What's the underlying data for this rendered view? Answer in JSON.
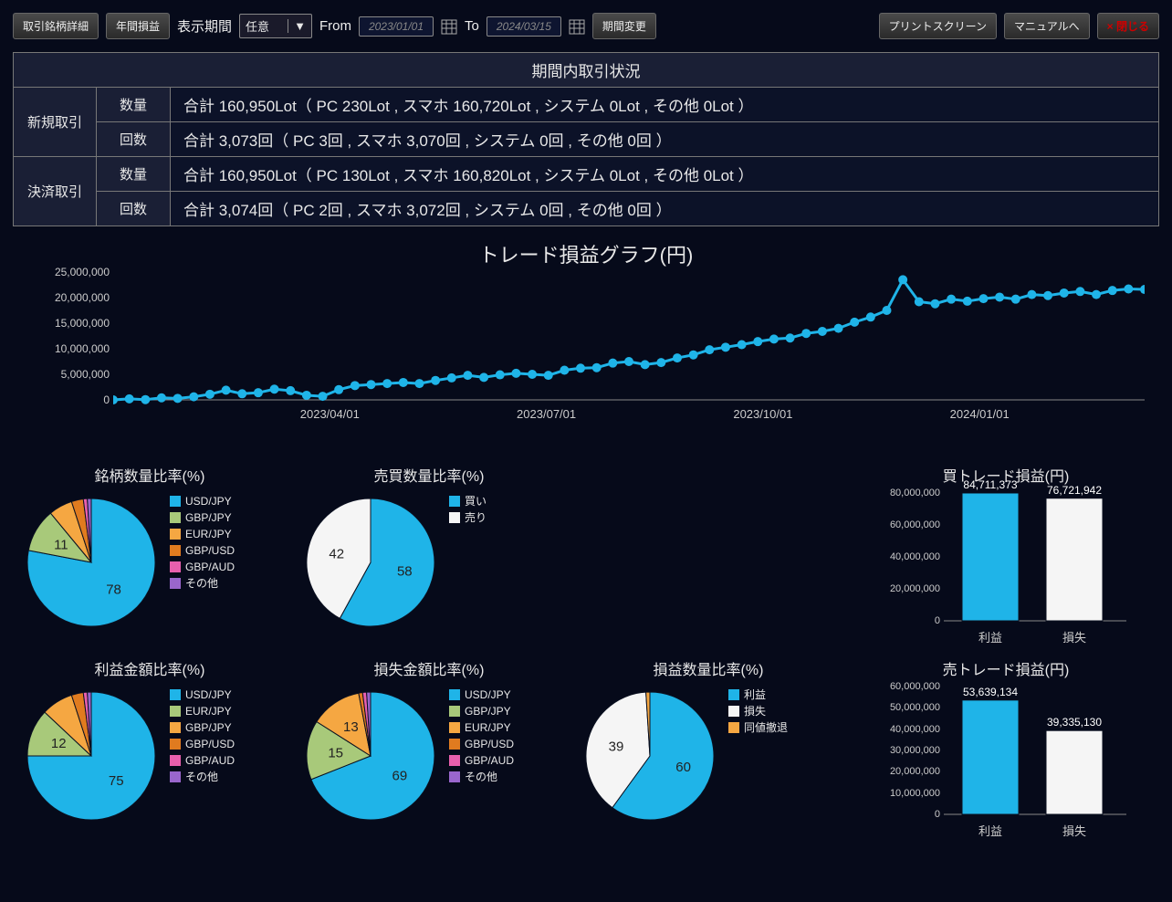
{
  "toolbar": {
    "btn_detail": "取引銘柄詳細",
    "btn_annual": "年間損益",
    "lbl_period": "表示期間",
    "sel_value": "任意",
    "lbl_from": "From",
    "date_from": "2023/01/01",
    "lbl_to": "To",
    "date_to": "2024/03/15",
    "btn_change": "期間変更",
    "btn_print": "プリントスクリーン",
    "btn_manual": "マニュアルへ",
    "btn_close": "× 閉じる"
  },
  "summary": {
    "title": "期間内取引状況",
    "rows": [
      {
        "side": "新規取引",
        "sub": "数量",
        "val": "合計 160,950Lot（ PC 230Lot , スマホ 160,720Lot , システム 0Lot , その他 0Lot ）"
      },
      {
        "side": "",
        "sub": "回数",
        "val": "合計 3,073回（ PC 3回 , スマホ 3,070回 , システム 0回 , その他 0回 ）"
      },
      {
        "side": "決済取引",
        "sub": "数量",
        "val": "合計 160,950Lot（ PC 130Lot , スマホ 160,820Lot , システム 0Lot , その他 0Lot ）"
      },
      {
        "side": "",
        "sub": "回数",
        "val": "合計 3,074回（ PC 2回 , スマホ 3,072回 , システム 0回 , その他 0回 ）"
      }
    ]
  },
  "lineTitle": "トレード損益グラフ(円)",
  "titles": {
    "pie1": "銘柄数量比率(%)",
    "pie2": "売買数量比率(%)",
    "bar1": "買トレード損益(円)",
    "pie3": "利益金額比率(%)",
    "pie4": "損失金額比率(%)",
    "pie5": "損益数量比率(%)",
    "bar2": "売トレード損益(円)"
  },
  "legends": {
    "pairs": [
      "USD/JPY",
      "GBP/JPY",
      "EUR/JPY",
      "GBP/USD",
      "GBP/AUD",
      "その他"
    ],
    "pairs2": [
      "USD/JPY",
      "EUR/JPY",
      "GBP/JPY",
      "GBP/USD",
      "GBP/AUD",
      "その他"
    ],
    "buysell": [
      "買い",
      "売り"
    ],
    "pl": [
      "利益",
      "損失",
      "同値撤退"
    ]
  },
  "bars": {
    "buy": {
      "profit_lbl": "利益",
      "loss_lbl": "損失",
      "profit": "84,711,373",
      "loss": "76,721,942"
    },
    "sell": {
      "profit_lbl": "利益",
      "loss_lbl": "損失",
      "profit": "53,639,134",
      "loss": "39,335,130"
    }
  },
  "chart_data": {
    "line": {
      "type": "line",
      "title": "トレード損益グラフ(円)",
      "ylim": [
        0,
        25000000
      ],
      "yticks": [
        0,
        5000000,
        10000000,
        15000000,
        20000000,
        25000000
      ],
      "xticks": [
        "2023/04/01",
        "2023/07/01",
        "2023/10/01",
        "2024/01/01"
      ],
      "x": [
        "2023/01/01",
        "2023/01/08",
        "2023/01/15",
        "2023/01/22",
        "2023/01/29",
        "2023/02/05",
        "2023/02/12",
        "2023/02/19",
        "2023/02/26",
        "2023/03/05",
        "2023/03/12",
        "2023/03/19",
        "2023/03/26",
        "2023/04/02",
        "2023/04/09",
        "2023/04/16",
        "2023/04/23",
        "2023/04/30",
        "2023/05/07",
        "2023/05/14",
        "2023/05/21",
        "2023/05/28",
        "2023/06/04",
        "2023/06/11",
        "2023/06/18",
        "2023/06/25",
        "2023/07/02",
        "2023/07/09",
        "2023/07/16",
        "2023/07/23",
        "2023/07/30",
        "2023/08/06",
        "2023/08/13",
        "2023/08/20",
        "2023/08/27",
        "2023/09/03",
        "2023/09/10",
        "2023/09/17",
        "2023/09/24",
        "2023/10/01",
        "2023/10/08",
        "2023/10/15",
        "2023/10/22",
        "2023/10/29",
        "2023/11/05",
        "2023/11/12",
        "2023/11/19",
        "2023/11/26",
        "2023/12/03",
        "2023/12/10",
        "2023/12/17",
        "2023/12/24",
        "2023/12/31",
        "2024/01/07",
        "2024/01/14",
        "2024/01/21",
        "2024/01/28",
        "2024/02/04",
        "2024/02/11",
        "2024/02/18",
        "2024/02/25",
        "2024/03/03",
        "2024/03/10",
        "2024/03/15"
      ],
      "values": [
        0,
        200000,
        50000,
        400000,
        300000,
        600000,
        1100000,
        1900000,
        1200000,
        1400000,
        2100000,
        1800000,
        900000,
        700000,
        2000000,
        2800000,
        3000000,
        3200000,
        3400000,
        3200000,
        3800000,
        4300000,
        4800000,
        4400000,
        4900000,
        5200000,
        5000000,
        4800000,
        5800000,
        6200000,
        6300000,
        7200000,
        7500000,
        6900000,
        7300000,
        8200000,
        8800000,
        9800000,
        10300000,
        10800000,
        11400000,
        11900000,
        12100000,
        13000000,
        13400000,
        14000000,
        15200000,
        16200000,
        17500000,
        23500000,
        19200000,
        18800000,
        19700000,
        19300000,
        19800000,
        20100000,
        19700000,
        20600000,
        20400000,
        20900000,
        21200000,
        20600000,
        21400000,
        21700000,
        21600000
      ]
    },
    "pie1": {
      "type": "pie",
      "title": "銘柄数量比率(%)",
      "series": [
        {
          "name": "USD/JPY",
          "value": 78
        },
        {
          "name": "GBP/JPY",
          "value": 11
        },
        {
          "name": "EUR/JPY",
          "value": 6
        },
        {
          "name": "GBP/USD",
          "value": 3
        },
        {
          "name": "GBP/AUD",
          "value": 1
        },
        {
          "name": "その他",
          "value": 1
        }
      ]
    },
    "pie2": {
      "type": "pie",
      "title": "売買数量比率(%)",
      "series": [
        {
          "name": "買い",
          "value": 58
        },
        {
          "name": "売り",
          "value": 42
        }
      ]
    },
    "pie3": {
      "type": "pie",
      "title": "利益金額比率(%)",
      "series": [
        {
          "name": "USD/JPY",
          "value": 75
        },
        {
          "name": "EUR/JPY",
          "value": 12
        },
        {
          "name": "GBP/JPY",
          "value": 8
        },
        {
          "name": "GBP/USD",
          "value": 3
        },
        {
          "name": "GBP/AUD",
          "value": 1
        },
        {
          "name": "その他",
          "value": 1
        }
      ]
    },
    "pie4": {
      "type": "pie",
      "title": "損失金額比率(%)",
      "series": [
        {
          "name": "USD/JPY",
          "value": 69
        },
        {
          "name": "GBP/JPY",
          "value": 15
        },
        {
          "name": "EUR/JPY",
          "value": 13
        },
        {
          "name": "GBP/USD",
          "value": 1
        },
        {
          "name": "GBP/AUD",
          "value": 1
        },
        {
          "name": "その他",
          "value": 1
        }
      ]
    },
    "pie5": {
      "type": "pie",
      "title": "損益数量比率(%)",
      "series": [
        {
          "name": "利益",
          "value": 60
        },
        {
          "name": "損失",
          "value": 39
        },
        {
          "name": "同値撤退",
          "value": 1
        }
      ]
    },
    "bar1": {
      "type": "bar",
      "title": "買トレード損益(円)",
      "categories": [
        "利益",
        "損失"
      ],
      "values": [
        84711373,
        76721942
      ],
      "ylim": [
        0,
        80000000
      ],
      "yticks": [
        0,
        20000000,
        40000000,
        60000000,
        80000000
      ]
    },
    "bar2": {
      "type": "bar",
      "title": "売トレード損益(円)",
      "categories": [
        "利益",
        "損失"
      ],
      "values": [
        53639134,
        39335130
      ],
      "ylim": [
        0,
        60000000
      ],
      "yticks": [
        0,
        10000000,
        20000000,
        30000000,
        40000000,
        50000000,
        60000000
      ]
    }
  },
  "colors": {
    "blue": "#1fb4e8",
    "green": "#a8c97a",
    "orange": "#f5a742",
    "darkorange": "#e07b1f",
    "pink": "#e85fad",
    "purple": "#9966cc",
    "white": "#f5f5f5"
  }
}
